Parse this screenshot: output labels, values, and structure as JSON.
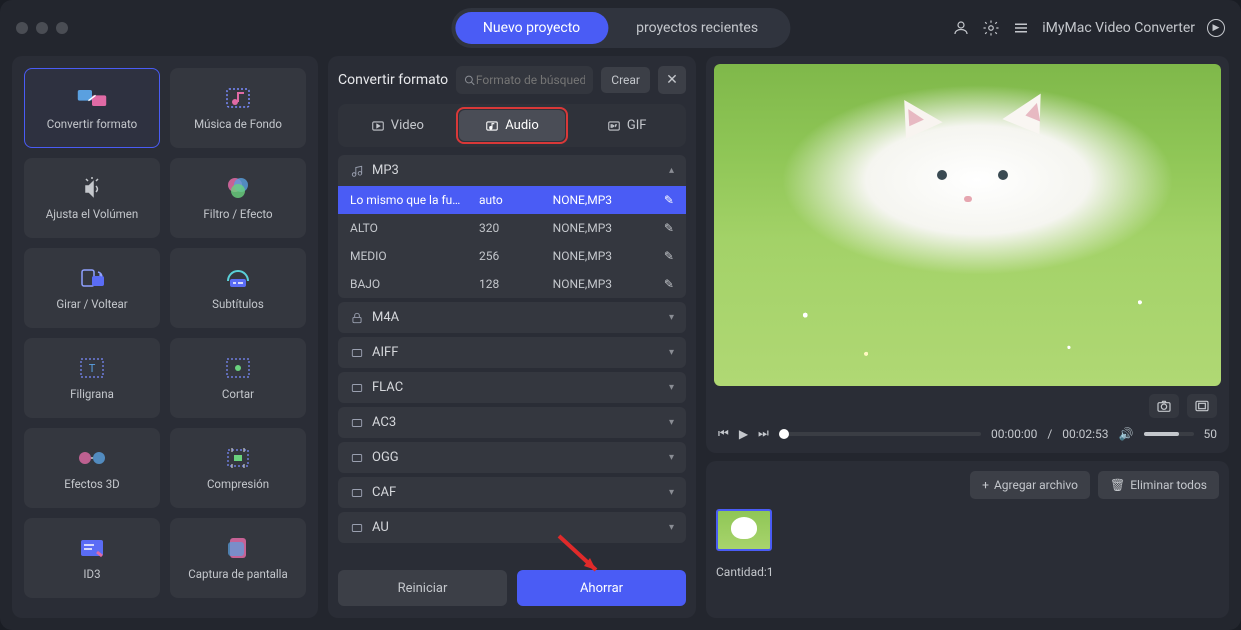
{
  "titlebar": {
    "new_project": "Nuevo proyecto",
    "recent_projects": "proyectos recientes",
    "app_name": "iMyMac Video Converter"
  },
  "sidebar": {
    "tools": [
      {
        "id": "convert",
        "label": "Convertir formato"
      },
      {
        "id": "bgmusic",
        "label": "Música de Fondo"
      },
      {
        "id": "volume",
        "label": "Ajusta el Volúmen"
      },
      {
        "id": "filter",
        "label": "Filtro / Efecto"
      },
      {
        "id": "rotate",
        "label": "Girar / Voltear"
      },
      {
        "id": "subtitles",
        "label": "Subtítulos"
      },
      {
        "id": "watermark",
        "label": "Filigrana"
      },
      {
        "id": "cut",
        "label": "Cortar"
      },
      {
        "id": "3d",
        "label": "Efectos 3D"
      },
      {
        "id": "compress",
        "label": "Compresión"
      },
      {
        "id": "id3",
        "label": "ID3"
      },
      {
        "id": "screenshot",
        "label": "Captura de pantalla"
      }
    ]
  },
  "middle": {
    "title": "Convertir formato",
    "search_placeholder": "Formato de búsqued",
    "create": "Crear",
    "tabs": {
      "video": "Video",
      "audio": "Audio",
      "gif": "GIF"
    },
    "groups": [
      {
        "name": "MP3",
        "expanded": true,
        "rows": [
          {
            "quality": "Lo mismo que la fu…",
            "bitrate": "auto",
            "codec": "NONE,MP3",
            "selected": true
          },
          {
            "quality": "ALTO",
            "bitrate": "320",
            "codec": "NONE,MP3"
          },
          {
            "quality": "MEDIO",
            "bitrate": "256",
            "codec": "NONE,MP3"
          },
          {
            "quality": "BAJO",
            "bitrate": "128",
            "codec": "NONE,MP3"
          }
        ]
      },
      {
        "name": "M4A"
      },
      {
        "name": "AIFF"
      },
      {
        "name": "FLAC"
      },
      {
        "name": "AC3"
      },
      {
        "name": "OGG"
      },
      {
        "name": "CAF"
      },
      {
        "name": "AU"
      }
    ],
    "reset": "Reiniciar",
    "save": "Ahorrar"
  },
  "player": {
    "current": "00:00:00",
    "total": "00:02:53",
    "volume": "50"
  },
  "bottom": {
    "add_file": "Agregar archivo",
    "delete_all": "Eliminar todos",
    "qty_label": "Cantidad:",
    "qty_value": "1"
  }
}
